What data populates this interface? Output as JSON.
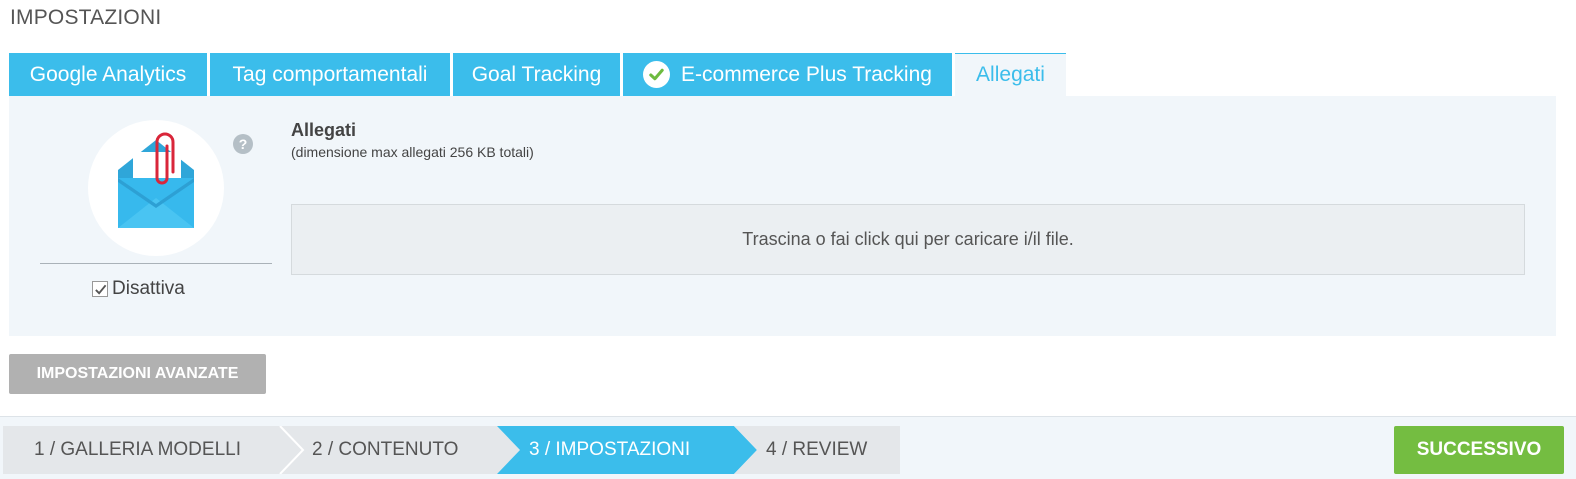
{
  "page": {
    "title": "IMPOSTAZIONI"
  },
  "tabs": [
    {
      "label": "Google Analytics",
      "active": false
    },
    {
      "label": "Tag comportamentali",
      "active": false
    },
    {
      "label": "Goal Tracking",
      "active": false
    },
    {
      "label": "E-commerce Plus Tracking",
      "active": false,
      "icon": "check-circle-icon"
    },
    {
      "label": "Allegati",
      "active": true
    }
  ],
  "attachments": {
    "title": "Allegati",
    "subtitle": "(dimensione max allegati 256 KB totali)",
    "dropzone_text": "Trascina o fai click qui per caricare i/il file.",
    "toggle_label": "Disattiva",
    "toggle_checked": true,
    "illustration": "envelope-paperclip-icon",
    "help_icon": "question-circle-icon"
  },
  "advanced_button": {
    "label": "IMPOSTAZIONI AVANZATE"
  },
  "wizard": {
    "steps": [
      {
        "label": "1 / GALLERIA MODELLI",
        "active": false
      },
      {
        "label": "2 / CONTENUTO",
        "active": false
      },
      {
        "label": "3 / IMPOSTAZIONI",
        "active": true
      },
      {
        "label": "4 / REVIEW",
        "active": false
      }
    ]
  },
  "next_button": {
    "label": "SUCCESSIVO"
  },
  "colors": {
    "tab_blue": "#3bbdeb",
    "panel_bg": "#f1f6fa",
    "success_green": "#74bd41",
    "check_green": "#6dbb3f",
    "step_gray": "#e4e7ea",
    "button_gray": "#b1b1b1"
  }
}
